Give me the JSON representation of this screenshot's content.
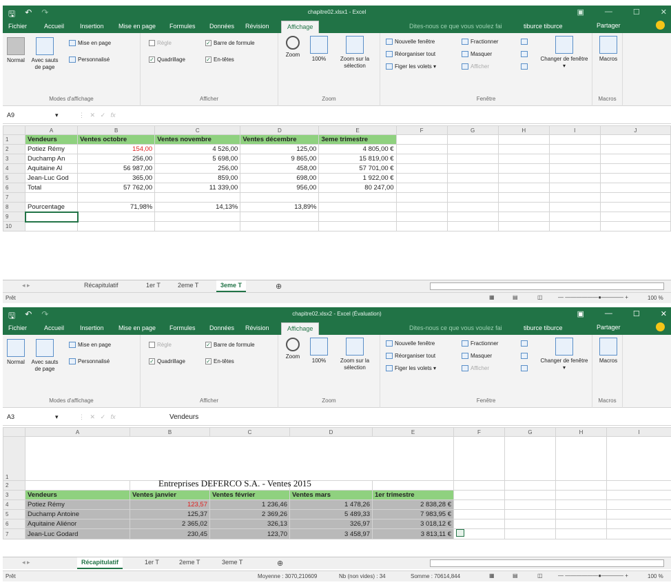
{
  "colors": {
    "accent": "#217346",
    "header_green": "#8fd17f",
    "selected_gray": "#b9b9b9",
    "negative_red": "#e02020"
  },
  "menu": {
    "fichier": "Fichier",
    "accueil": "Accueil",
    "insertion": "Insertion",
    "mise_en_page": "Mise en page",
    "formules": "Formules",
    "donnees": "Données",
    "revision": "Révision",
    "affichage": "Affichage",
    "tell_me": "Dites-nous ce que vous voulez fai",
    "user": "tiburce tiburce",
    "share": "Partager"
  },
  "ribbon": {
    "normal": "Normal",
    "sauts": "Avec sauts de page",
    "mise_en_page": "Mise en page",
    "personnalise": "Personnalisé",
    "modes_label": "Modes d'affichage",
    "regle": "Règle",
    "barre_formule": "Barre de formule",
    "quadrillage": "Quadrillage",
    "en_tetes": "En-têtes",
    "afficher_label": "Afficher",
    "zoom": "Zoom",
    "zoom100": "100%",
    "zoom_sel": "Zoom sur la sélection",
    "zoom_label": "Zoom",
    "nouvelle_fenetre": "Nouvelle fenêtre",
    "reorganiser": "Réorganiser tout",
    "figer": "Figer les volets",
    "fractionner": "Fractionner",
    "masquer": "Masquer",
    "afficher_btn": "Afficher",
    "changer": "Changer de fenêtre",
    "fenetre_label": "Fenêtre",
    "macros": "Macros",
    "macros_label": "Macros"
  },
  "w1": {
    "title": "chapitre02.xlsx1 - Excel",
    "namebox": "A9",
    "fx": "",
    "cols": [
      "A",
      "B",
      "C",
      "D",
      "E",
      "F",
      "G",
      "H",
      "I",
      "J"
    ],
    "rows": [
      {
        "n": "1",
        "cells": [
          "Vendeurs",
          "Ventes octobre",
          "Ventes novembre",
          "Ventes décembre",
          "3eme trimestre"
        ]
      },
      {
        "n": "2",
        "cells": [
          "Potiez Rémy",
          "154,00",
          "4 526,00",
          "125,00",
          "4 805,00 €"
        ]
      },
      {
        "n": "3",
        "cells": [
          "Duchamp An",
          "256,00",
          "5 698,00",
          "9 865,00",
          "15 819,00 €"
        ]
      },
      {
        "n": "4",
        "cells": [
          "Aquitaine Al",
          "56 987,00",
          "256,00",
          "458,00",
          "57 701,00 €"
        ]
      },
      {
        "n": "5",
        "cells": [
          "Jean-Luc God",
          "365,00",
          "859,00",
          "698,00",
          "1 922,00 €"
        ]
      },
      {
        "n": "6",
        "cells": [
          "Total",
          "57 762,00",
          "11 339,00",
          "956,00",
          "80 247,00"
        ]
      },
      {
        "n": "7",
        "cells": [
          "",
          "",
          "",
          "",
          ""
        ]
      },
      {
        "n": "8",
        "cells": [
          "Pourcentage",
          "71,98%",
          "14,13%",
          "13,89%",
          ""
        ]
      },
      {
        "n": "9",
        "cells": [
          "",
          "",
          "",
          "",
          ""
        ]
      },
      {
        "n": "10",
        "cells": [
          "",
          "",
          "",
          "",
          ""
        ]
      }
    ],
    "sheets": [
      "Récapitulatif",
      "1er T",
      "2eme T",
      "3eme T"
    ],
    "status": "Prêt",
    "zoom": "100 %"
  },
  "w2": {
    "title": "chapitre02.xlsx2 - Excel (Évaluation)",
    "namebox": "A3",
    "fx": "Vendeurs",
    "cols": [
      "A",
      "B",
      "C",
      "D",
      "E",
      "F",
      "G",
      "H",
      "I"
    ],
    "big_title": "Entreprises DEFERCO S.A. - Ventes 2015",
    "rows": [
      {
        "n": "3",
        "cells": [
          "Vendeurs",
          "Ventes janvier",
          "Ventes février",
          "Ventes mars",
          "1er trimestre"
        ]
      },
      {
        "n": "4",
        "cells": [
          "Potiez Rémy",
          "123,57",
          "1 236,46",
          "1 478,26",
          "2 838,28 €"
        ]
      },
      {
        "n": "5",
        "cells": [
          "Duchamp Antoine",
          "125,37",
          "2 369,26",
          "5 489,33",
          "7 983,95 €"
        ]
      },
      {
        "n": "6",
        "cells": [
          "Aquitaine Aliénor",
          "2 365,02",
          "326,13",
          "326,97",
          "3 018,12 €"
        ]
      },
      {
        "n": "7",
        "cells": [
          "Jean-Luc Godard",
          "230,45",
          "123,70",
          "3 458,97",
          "3 813,11 €"
        ]
      }
    ],
    "sheets": [
      "Récapitulatif",
      "1er T",
      "2eme T",
      "3eme T"
    ],
    "status": "Prêt",
    "moyenne": "Moyenne : 3070,210609",
    "nb": "Nb (non vides) : 34",
    "somme": "Somme : 70614,844",
    "zoom": "100 %"
  }
}
